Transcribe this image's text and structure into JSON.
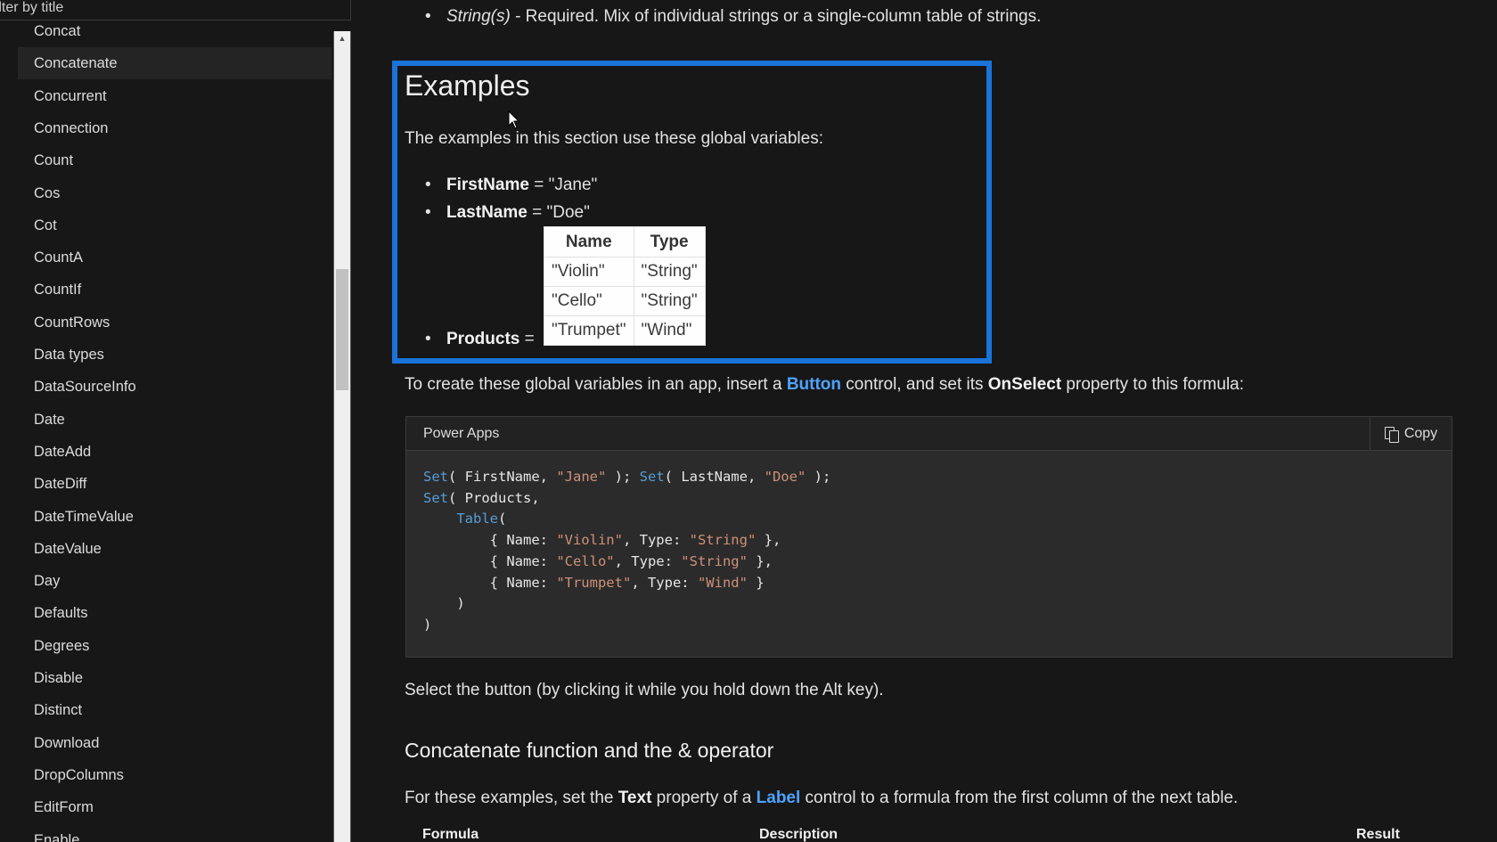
{
  "sidebar": {
    "filter_placeholder": "Filter by title",
    "items": [
      {
        "label": "Concat",
        "active": false
      },
      {
        "label": "Concatenate",
        "active": true
      },
      {
        "label": "Concurrent",
        "active": false
      },
      {
        "label": "Connection",
        "active": false
      },
      {
        "label": "Count",
        "active": false
      },
      {
        "label": "Cos",
        "active": false
      },
      {
        "label": "Cot",
        "active": false
      },
      {
        "label": "CountA",
        "active": false
      },
      {
        "label": "CountIf",
        "active": false
      },
      {
        "label": "CountRows",
        "active": false
      },
      {
        "label": "Data types",
        "active": false
      },
      {
        "label": "DataSourceInfo",
        "active": false
      },
      {
        "label": "Date",
        "active": false
      },
      {
        "label": "DateAdd",
        "active": false
      },
      {
        "label": "DateDiff",
        "active": false
      },
      {
        "label": "DateTimeValue",
        "active": false
      },
      {
        "label": "DateValue",
        "active": false
      },
      {
        "label": "Day",
        "active": false
      },
      {
        "label": "Defaults",
        "active": false
      },
      {
        "label": "Degrees",
        "active": false
      },
      {
        "label": "Disable",
        "active": false
      },
      {
        "label": "Distinct",
        "active": false
      },
      {
        "label": "Download",
        "active": false
      },
      {
        "label": "DropColumns",
        "active": false
      },
      {
        "label": "EditForm",
        "active": false
      },
      {
        "label": "Enable",
        "active": false
      }
    ]
  },
  "main": {
    "param_bullet": {
      "name": "String(s)",
      "text": " - Required. Mix of individual strings or a single-column table of strings."
    },
    "examples": {
      "heading": "Examples",
      "intro": "The examples in this section use these global variables:",
      "variables": [
        {
          "name": "FirstName",
          "value": " = \"Jane\""
        },
        {
          "name": "LastName",
          "value": " = \"Doe\""
        },
        {
          "name": "Products",
          "value": " ="
        }
      ],
      "products_table": {
        "headers": [
          "Name",
          "Type"
        ],
        "rows": [
          [
            "\"Violin\"",
            "\"String\""
          ],
          [
            "\"Cello\"",
            "\"String\""
          ],
          [
            "\"Trumpet\"",
            "\"Wind\""
          ]
        ]
      },
      "highlight_color": "#1a73d9"
    },
    "create_para": {
      "part1": "To create these global variables in an app, insert a ",
      "link": "Button",
      "part2": " control, and set its ",
      "bold": "OnSelect",
      "part3": " property to this formula:"
    },
    "code_block": {
      "language": "Power Apps",
      "copy_label": "Copy",
      "lines": [
        [
          {
            "t": "Set",
            "c": "kw"
          },
          {
            "t": "( FirstName, "
          },
          {
            "t": "\"Jane\"",
            "c": "str"
          },
          {
            "t": " ); "
          },
          {
            "t": "Set",
            "c": "kw"
          },
          {
            "t": "( LastName, "
          },
          {
            "t": "\"Doe\"",
            "c": "str"
          },
          {
            "t": " );"
          }
        ],
        [
          {
            "t": "Set",
            "c": "kw"
          },
          {
            "t": "( Products,"
          }
        ],
        [
          {
            "t": "    "
          },
          {
            "t": "Table",
            "c": "kw"
          },
          {
            "t": "("
          }
        ],
        [
          {
            "t": "        { Name: "
          },
          {
            "t": "\"Violin\"",
            "c": "str"
          },
          {
            "t": ", Type: "
          },
          {
            "t": "\"String\"",
            "c": "str"
          },
          {
            "t": " },"
          }
        ],
        [
          {
            "t": "        { Name: "
          },
          {
            "t": "\"Cello\"",
            "c": "str"
          },
          {
            "t": ", Type: "
          },
          {
            "t": "\"String\"",
            "c": "str"
          },
          {
            "t": " },"
          }
        ],
        [
          {
            "t": "        { Name: "
          },
          {
            "t": "\"Trumpet\"",
            "c": "str"
          },
          {
            "t": ", Type: "
          },
          {
            "t": "\"Wind\"",
            "c": "str"
          },
          {
            "t": " }"
          }
        ],
        [
          {
            "t": "    )"
          }
        ],
        [
          {
            "t": ")"
          }
        ]
      ]
    },
    "select_para": "Select the button (by clicking it while you hold down the Alt key).",
    "subheading": "Concatenate function and the & operator",
    "label_para": {
      "part1": "For these examples, set the ",
      "bold": "Text",
      "part2": " property of a ",
      "link": "Label",
      "part3": " control to a formula from the first column of the next table."
    },
    "results_table_headers": [
      "Formula",
      "Description",
      "Result"
    ]
  }
}
